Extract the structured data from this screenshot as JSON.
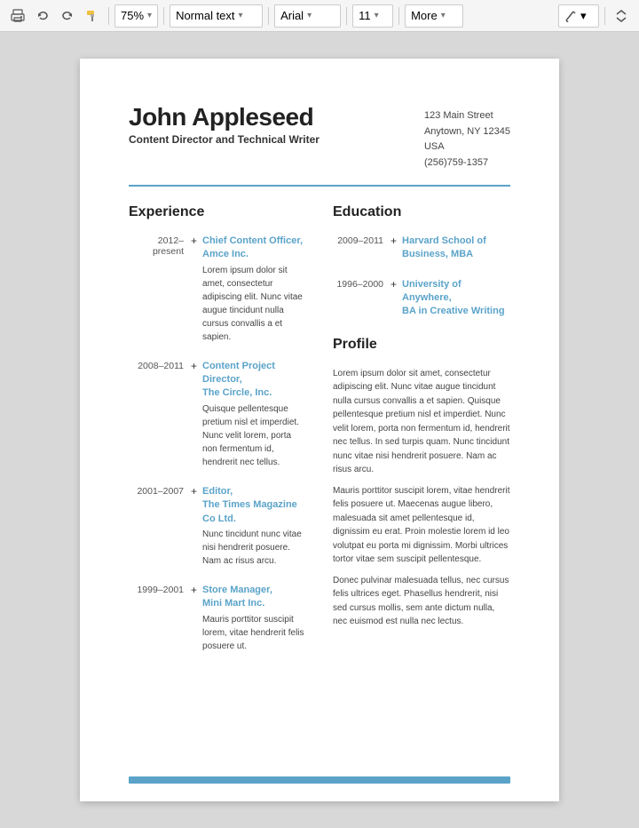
{
  "toolbar": {
    "zoom": "75%",
    "text_style": "Normal text",
    "font": "Arial",
    "font_size": "11",
    "more_label": "More",
    "zoom_arrow": "▾",
    "style_arrow": "▾",
    "font_arrow": "▾",
    "size_arrow": "▾",
    "more_arrow": "▾"
  },
  "resume": {
    "name": "John Appleseed",
    "job_title": "Content Director and Technical Writer",
    "address_line1": "123 Main Street",
    "address_line2": "Anytown, NY 12345",
    "address_line3": "USA",
    "phone": "(256)759-1357",
    "experience_heading": "Experience",
    "education_heading": "Education",
    "profile_heading": "Profile",
    "experience": [
      {
        "dates": "2012–present",
        "title": "Chief Content Officer, Amce Inc.",
        "body": "Lorem ipsum dolor sit amet, consectetur adipiscing elit. Nunc vitae augue tincidunt nulla cursus convallis a et sapien."
      },
      {
        "dates": "2008–2011",
        "title": "Content Project Director, The Circle, Inc.",
        "body": "Quisque pellentesque pretium nisl et imperdiet. Nunc velit lorem, porta non fermentum id, hendrerit nec tellus."
      },
      {
        "dates": "2001–2007",
        "title": "Editor, The Times Magazine Co Ltd.",
        "body": "Nunc tincidunt nunc vitae nisi hendrerit posuere. Nam ac risus arcu."
      },
      {
        "dates": "1999–2001",
        "title": "Store Manager, Mini Mart Inc.",
        "body": "Mauris porttitor suscipit lorem, vitae hendrerit felis posuere ut."
      }
    ],
    "education": [
      {
        "dates": "2009–2011",
        "title": "Harvard School of Business, MBA"
      },
      {
        "dates": "1996–2000",
        "title": "University of Anywhere, BA in Creative Writing"
      }
    ],
    "profile_paragraphs": [
      "Lorem ipsum dolor sit amet, consectetur adipiscing elit. Nunc vitae augue tincidunt nulla cursus convallis a et sapien. Quisque pellentesque pretium nisl et imperdiet. Nunc velit lorem, porta non fermentum id, hendrerit nec tellus. In sed turpis quam. Nunc tincidunt nunc vitae nisi hendrerit posuere. Nam ac risus arcu.",
      "Mauris porttitor suscipit lorem, vitae hendrerit felis posuere ut. Maecenas augue libero, malesuada sit amet pellentesque id, dignissim eu erat. Proin molestie lorem id leo volutpat eu porta mi dignissim. Morbi ultrices tortor vitae sem suscipit pellentesque.",
      "Donec pulvinar malesuada tellus, nec cursus felis ultrices eget. Phasellus hendrerit, nisi sed cursus mollis, sem ante dictum nulla, nec euismod est nulla nec lectus."
    ]
  }
}
